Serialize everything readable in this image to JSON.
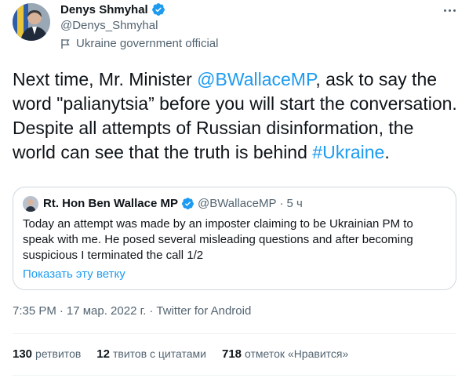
{
  "author": {
    "name": "Denys Shmyhal",
    "handle": "@Denys_Shmyhal",
    "label": "Ukraine government official",
    "label_icon": "flag-icon",
    "verified_icon": "verified-badge-icon"
  },
  "menu_icon": "more-icon",
  "tweet": {
    "text_prefix": "Next time, Mr. Minister ",
    "mention": "@BWallaceMP",
    "text_middle": ", ask to say the word \"palianytsia” before you will start the conversation. Despite all attempts of Russian disinformation, the world can see that the truth is behind ",
    "hashtag": "#Ukraine",
    "text_suffix": "."
  },
  "quote": {
    "name": "Rt. Hon Ben Wallace MP",
    "handle": "@BWallaceMP",
    "separator": "·",
    "time": "5 ч",
    "text": "Today an attempt was made by an imposter claiming to be Ukrainian PM to speak with me. He posed several misleading questions and after becoming suspicious I terminated the call 1/2",
    "show_thread": "Показать эту ветку"
  },
  "meta": {
    "time": "7:35 PM",
    "separator": "·",
    "date": "17 мар. 2022 г.",
    "separator2": "·",
    "source": "Twitter for Android"
  },
  "stats": {
    "retweets": {
      "count": "130",
      "label": "ретвитов"
    },
    "quotes": {
      "count": "12",
      "label": "твитов с цитатами"
    },
    "likes": {
      "count": "718",
      "label": "отметок «Нравится»"
    }
  },
  "colors": {
    "accent": "#1d9bf0",
    "text": "#0f1419",
    "secondary": "#536471",
    "border": "#cfd9de"
  }
}
